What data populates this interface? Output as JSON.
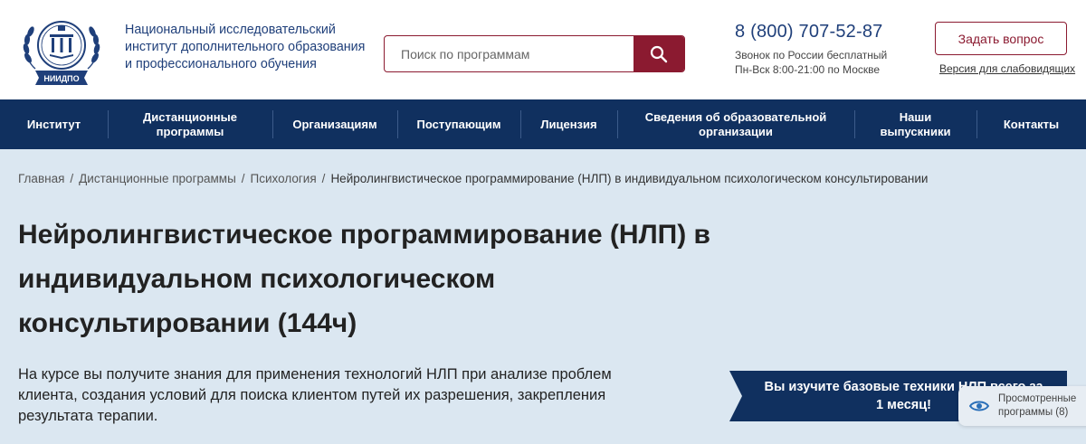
{
  "header": {
    "logo_text": "НИИДПО",
    "org_name_lines": [
      "Национальный исследовательский",
      "институт дополнительного образования",
      "и профессионального обучения"
    ],
    "search": {
      "placeholder": "Поиск по программам",
      "value": ""
    },
    "phone": "8 (800) 707-52-87",
    "phone_note_lines": [
      "Звонок по России бесплатный",
      "Пн-Вск 8:00-21:00 по Москве"
    ],
    "ask_button": "Задать вопрос",
    "accessibility_link": "Версия для слабовидящих"
  },
  "nav": {
    "items": [
      {
        "label": "Институт"
      },
      {
        "label_lines": [
          "Дистанционные",
          "программы"
        ]
      },
      {
        "label": "Организациям"
      },
      {
        "label": "Поступающим"
      },
      {
        "label": "Лицензия"
      },
      {
        "label_lines": [
          "Сведения об образовательной",
          "организации"
        ]
      },
      {
        "label_lines": [
          "Наши",
          "выпускники"
        ]
      },
      {
        "label": "Контакты"
      }
    ]
  },
  "breadcrumb": {
    "separator": "/",
    "items": [
      "Главная",
      "Дистанционные программы",
      "Психология",
      "Нейролингвистическое программирование (НЛП) в индивидуальном психологическом консультировании"
    ]
  },
  "page": {
    "title_lines": [
      "Нейролингвистическое программирование (НЛП) в",
      "индивидуальном психологическом",
      "консультировании (144ч)"
    ],
    "description_lines": [
      "На курсе вы получите знания для применения технологий НЛП при анализе проблем",
      "клиента, создания условий для поиска клиентом путей их разрешения, закрепления",
      "результата терапии."
    ],
    "promo_lines": [
      "Вы изучите базовые техники НЛП всего за",
      "1 месяц!"
    ]
  },
  "viewed_widget": {
    "lines": [
      "Просмотренные",
      "программы (8)"
    ],
    "icon": "eye-icon"
  },
  "colors": {
    "brand_navy": "#10305f",
    "accent_burgundy": "#8b1a30",
    "page_bg": "#dbe7f1",
    "org_text": "#1f3f7a"
  }
}
